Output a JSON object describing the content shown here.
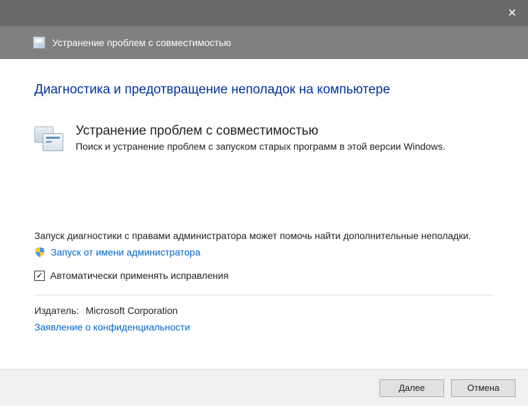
{
  "titlebar": {
    "close_glyph": "✕"
  },
  "header": {
    "title": "Устранение проблем с совместимостью"
  },
  "main": {
    "heading": "Диагностика и предотвращение неполадок на компьютере",
    "troubleshooter": {
      "title": "Устранение проблем с совместимостью",
      "description": "Поиск и устранение проблем с запуском старых программ в этой версии Windows."
    },
    "admin_paragraph": "Запуск диагностики с правами администратора может помочь найти дополнительные неполадки.",
    "admin_link": "Запуск от имени администратора",
    "auto_apply_checkbox": {
      "checked_glyph": "✓",
      "label": "Автоматически применять исправления"
    },
    "publisher": {
      "label": "Издатель:",
      "value": "Microsoft Corporation"
    },
    "privacy_link": "Заявление о конфиденциальности"
  },
  "footer": {
    "next": "Далее",
    "cancel": "Отмена"
  }
}
